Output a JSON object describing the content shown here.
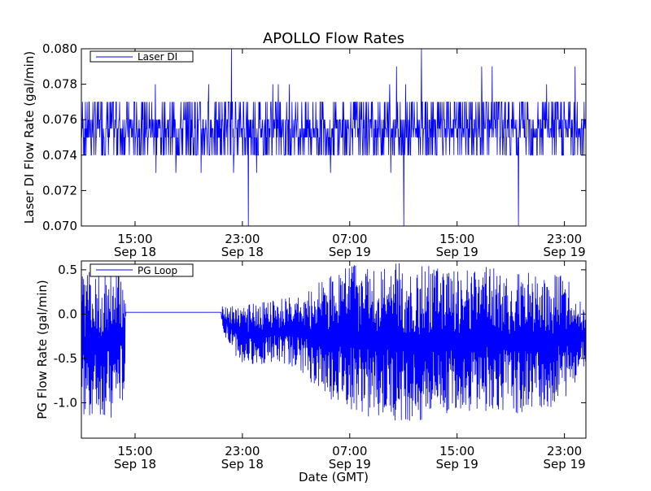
{
  "chart_data": [
    {
      "type": "line",
      "title": "APOLLO Flow Rates",
      "xlabel": "",
      "ylabel": "Laser DI Flow Rate (gal/min)",
      "legend": {
        "placement": "top-left",
        "entries": [
          "Laser DI"
        ]
      },
      "ylim": [
        0.07,
        0.08
      ],
      "yticks": [
        0.07,
        0.072,
        0.074,
        0.076,
        0.078,
        0.08
      ],
      "ytick_labels": [
        "0.070",
        "0.072",
        "0.074",
        "0.076",
        "0.078",
        "0.080"
      ],
      "xlim_hours": [
        11.0,
        24.7
      ],
      "xticks": [
        {
          "hour": 15,
          "line1": "15:00",
          "line2": "Sep 18"
        },
        {
          "hour": 23,
          "line1": "23:00",
          "line2": "Sep 18"
        },
        {
          "hour": 31,
          "line1": "07:00",
          "line2": "Sep 19"
        },
        {
          "hour": 39,
          "line1": "15:00",
          "line2": "Sep 19"
        },
        {
          "hour": 47,
          "line1": "23:00",
          "line2": "Sep 19"
        }
      ],
      "grid": false,
      "series": [
        {
          "name": "Laser DI",
          "color": "#0000ff",
          "baseline": 0.0755,
          "values": [
            0.0755,
            0.075,
            0.076,
            0.0755,
            0.078,
            0.074,
            0.076,
            0.0755,
            0.073,
            0.077,
            0.0755,
            0.075,
            0.076,
            0.079,
            0.0755,
            0.074,
            0.076,
            0.0755,
            0.071,
            0.077,
            0.0755,
            0.076,
            0.074,
            0.078,
            0.0755,
            0.075,
            0.076,
            0.073,
            0.0755,
            0.077,
            0.076,
            0.0755,
            0.074,
            0.072,
            0.079,
            0.0755,
            0.076,
            0.075,
            0.0755,
            0.078,
            0.073,
            0.076,
            0.0755,
            0.074,
            0.077,
            0.0755,
            0.08,
            0.07,
            0.0755,
            0.076,
            0.074,
            0.078,
            0.0755,
            0.075,
            0.076,
            0.072,
            0.0755,
            0.077,
            0.076,
            0.074,
            0.0755,
            0.079,
            0.073,
            0.076,
            0.0755,
            0.075,
            0.078,
            0.0755,
            0.07,
            0.076,
            0.074,
            0.0755,
            0.077,
            0.076,
            0.0755,
            0.073,
            0.08,
            0.0755,
            0.074,
            0.076
          ]
        }
      ]
    },
    {
      "type": "line",
      "title": "",
      "xlabel": "Date (GMT)",
      "ylabel": "PG Flow Rate (gal/min)",
      "legend": {
        "placement": "top-left",
        "entries": [
          "PG Loop"
        ]
      },
      "ylim": [
        -1.4,
        0.6
      ],
      "yticks": [
        -1.0,
        -0.5,
        0.0,
        0.5
      ],
      "ytick_labels": [
        "-1.0",
        "-0.5",
        "0.0",
        "0.5"
      ],
      "xlim_hours": [
        11.0,
        24.7
      ],
      "xticks": [
        {
          "hour": 15,
          "line1": "15:00",
          "line2": "Sep 18"
        },
        {
          "hour": 23,
          "line1": "23:00",
          "line2": "Sep 18"
        },
        {
          "hour": 31,
          "line1": "07:00",
          "line2": "Sep 19"
        },
        {
          "hour": 39,
          "line1": "15:00",
          "line2": "Sep 19"
        },
        {
          "hour": 47,
          "line1": "23:00",
          "line2": "Sep 19"
        }
      ],
      "grid": false,
      "series": [
        {
          "name": "PG Loop",
          "color": "#0000ff",
          "envelope": [
            {
              "hour": 11.0,
              "low": -1.15,
              "high": 0.45
            },
            {
              "hour": 13.0,
              "low": -1.2,
              "high": 0.55
            },
            {
              "hour": 14.2,
              "low": -1.05,
              "high": 0.6
            },
            {
              "hour": 14.3,
              "low": 0.02,
              "high": 0.02
            },
            {
              "hour": 21.4,
              "low": 0.02,
              "high": 0.02
            },
            {
              "hour": 21.5,
              "low": -0.2,
              "high": 0.1
            },
            {
              "hour": 23.0,
              "low": -0.6,
              "high": 0.1
            },
            {
              "hour": 25.0,
              "low": -0.55,
              "high": 0.15
            },
            {
              "hour": 27.0,
              "low": -0.6,
              "high": 0.2
            },
            {
              "hour": 29.0,
              "low": -0.95,
              "high": 0.4
            },
            {
              "hour": 31.0,
              "low": -1.1,
              "high": 0.55
            },
            {
              "hour": 33.0,
              "low": -1.2,
              "high": 0.6
            },
            {
              "hour": 35.0,
              "low": -1.25,
              "high": 0.6
            },
            {
              "hour": 37.0,
              "low": -1.2,
              "high": 0.55
            },
            {
              "hour": 39.0,
              "low": -1.1,
              "high": 0.5
            },
            {
              "hour": 41.0,
              "low": -1.1,
              "high": 0.55
            },
            {
              "hour": 43.0,
              "low": -1.15,
              "high": 0.5
            },
            {
              "hour": 45.0,
              "low": -1.1,
              "high": 0.45
            },
            {
              "hour": 47.0,
              "low": -1.0,
              "high": 0.45
            },
            {
              "hour": 48.5,
              "low": -0.6,
              "high": 0.1
            }
          ]
        }
      ]
    }
  ]
}
